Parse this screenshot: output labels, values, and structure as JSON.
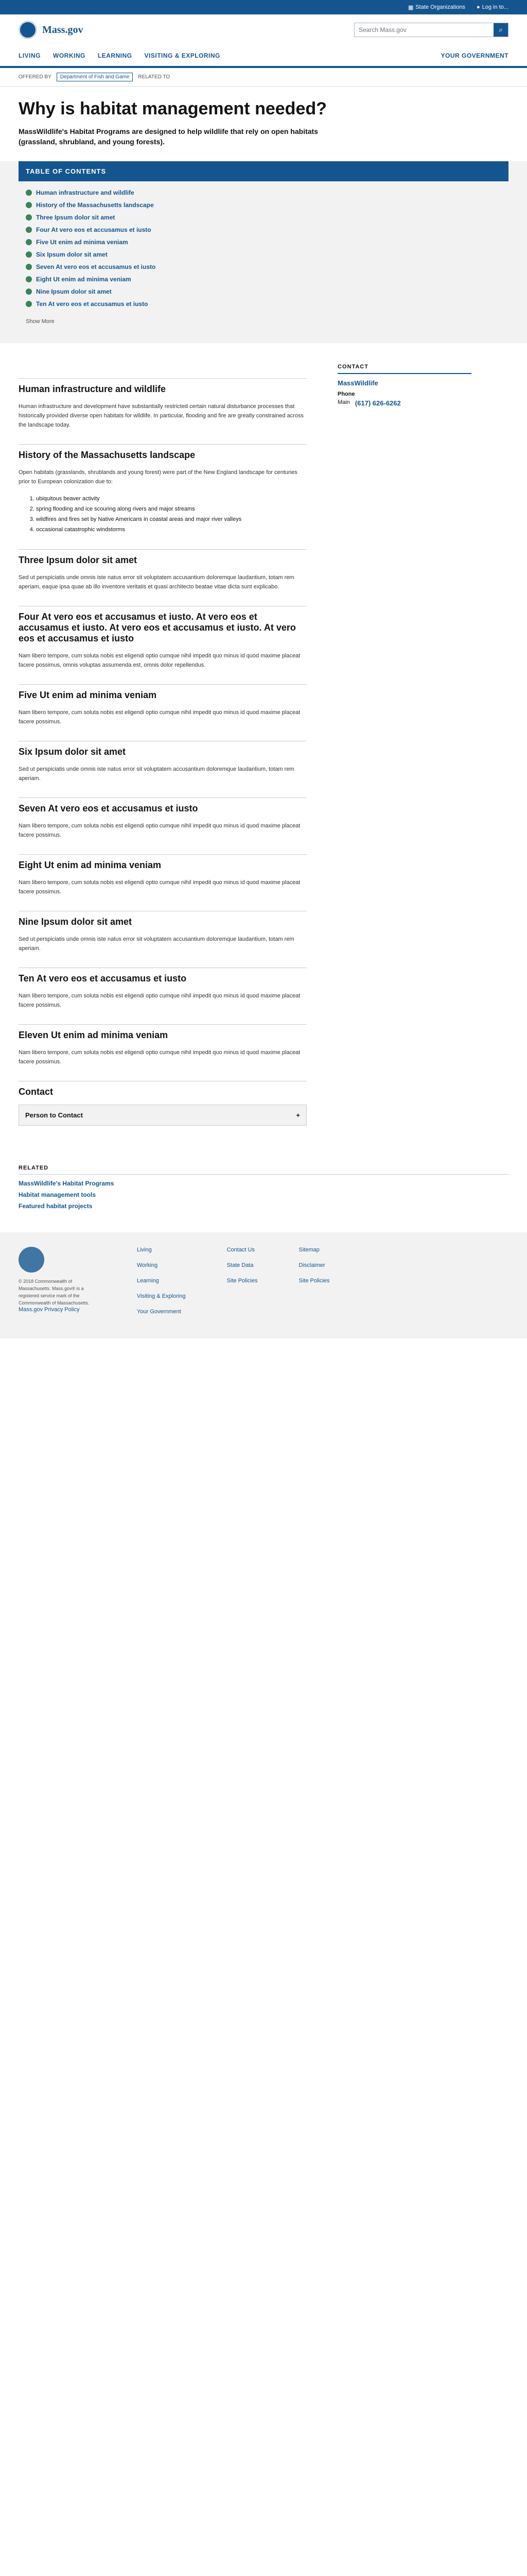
{
  "header": {
    "topbar_items": [
      "State Organizations",
      "Log in to..."
    ],
    "logo": "Mass.gov",
    "search_placeholder": "Search Mass.gov"
  },
  "nav": [
    "Living",
    "Working",
    "Learning",
    "Visiting & Exploring",
    "Your Government"
  ],
  "meta": {
    "offered_by": "OFFERED BY",
    "org": "Department of Fish and Game",
    "related": "RELATED TO"
  },
  "hero": {
    "title": "Why is habitat management needed?",
    "lead": "MassWildlife's Habitat Programs are designed to help wildlife that rely on open habitats (grassland, shrubland, and young forests)."
  },
  "toc": {
    "title": "TABLE OF CONTENTS",
    "items": [
      "Human infrastructure and wildlife",
      "History of the Massachusetts landscape",
      "Three Ipsum dolor sit amet",
      "Four At vero eos et accusamus et iusto",
      "Five Ut enim ad minima veniam",
      "Six Ipsum dolor sit amet",
      "Seven At vero eos et accusamus et iusto",
      "Eight Ut enim ad minima veniam",
      "Nine Ipsum dolor sit amet",
      "Ten At vero eos et accusamus et iusto"
    ],
    "more": "Show More"
  },
  "side": {
    "title": "CONTACT",
    "name": "MassWildlife",
    "phone_label": "Phone",
    "phone_main": "Main",
    "phone": "(617) 626-6262"
  },
  "sections": [
    {
      "h": "Human infrastructure and wildlife",
      "p": "Human infrastructure and development have substantially restricted certain natural disturbance processes that historically provided diverse open habitats for wildlife. In particular, flooding and fire are greatly constrained across the landscape today."
    },
    {
      "h": "History of the Massachusetts landscape",
      "p": "Open habitats (grasslands, shrublands and young forest) were part of the New England landscape for centuries prior to European colonization due to:"
    },
    {
      "h": "Three Ipsum dolor sit amet",
      "p": "Sed ut perspiciatis unde omnis iste natus error sit voluptatem accusantium doloremque laudantium, totam rem aperiam, eaque ipsa quae ab illo inventore veritatis et quasi architecto beatae vitae dicta sunt explicabo."
    },
    {
      "h": "Four At vero eos et accusamus et iusto. At vero eos et accusamus et iusto. At vero eos et accusamus et iusto. At vero eos et accusamus et iusto",
      "p": "Nam libero tempore, cum soluta nobis est eligendi optio cumque nihil impedit quo minus id quod maxime placeat facere possimus, omnis voluptas assumenda est, omnis dolor repellendus."
    },
    {
      "h": "Five Ut enim ad minima veniam",
      "p": "Nam libero tempore, cum soluta nobis est eligendi optio cumque nihil impedit quo minus id quod maxime placeat facere possimus."
    },
    {
      "h": "Six Ipsum dolor sit amet",
      "p": "Sed ut perspiciatis unde omnis iste natus error sit voluptatem accusantium doloremque laudantium, totam rem aperiam."
    },
    {
      "h": "Seven At vero eos et accusamus et iusto",
      "p": "Nam libero tempore, cum soluta nobis est eligendi optio cumque nihil impedit quo minus id quod maxime placeat facere possimus."
    },
    {
      "h": "Eight Ut enim ad minima veniam",
      "p": "Nam libero tempore, cum soluta nobis est eligendi optio cumque nihil impedit quo minus id quod maxime placeat facere possimus."
    },
    {
      "h": "Nine Ipsum dolor sit amet",
      "p": "Sed ut perspiciatis unde omnis iste natus error sit voluptatem accusantium doloremque laudantium, totam rem aperiam."
    },
    {
      "h": "Ten At vero eos et accusamus et iusto",
      "p": "Nam libero tempore, cum soluta nobis est eligendi optio cumque nihil impedit quo minus id quod maxime placeat facere possimus."
    },
    {
      "h": "Eleven Ut enim ad minima veniam",
      "p": "Nam libero tempore, cum soluta nobis est eligendi optio cumque nihil impedit quo minus id quod maxime placeat facere possimus."
    }
  ],
  "list": [
    "ubiquitous beaver activity",
    "spring flooding and ice scouring along rivers and major streams",
    "wildfires and fires set by Native Americans in coastal areas and major river valleys",
    "occasional catastrophic windstorms"
  ],
  "contact": {
    "title": "Contact",
    "button": "Person to Contact"
  },
  "related": {
    "title": "RELATED",
    "items": [
      "MassWildlife's Habitat Programs",
      "Habitat management tools",
      "Featured habitat projects"
    ]
  },
  "footer": {
    "col1": [
      "Living",
      "Working",
      "Learning",
      "Visiting & Exploring",
      "Your Government"
    ],
    "col2": [
      "Contact Us",
      "State Data",
      "Site Policies"
    ],
    "col3": [
      "Sitemap",
      "Disclaimer",
      "Site Policies"
    ],
    "copyright": "© 2018 Commonwealth of Massachusetts. Mass.gov® is a registered service mark of the Commonwealth of Massachusetts.",
    "privacy": "Mass.gov Privacy Policy"
  }
}
